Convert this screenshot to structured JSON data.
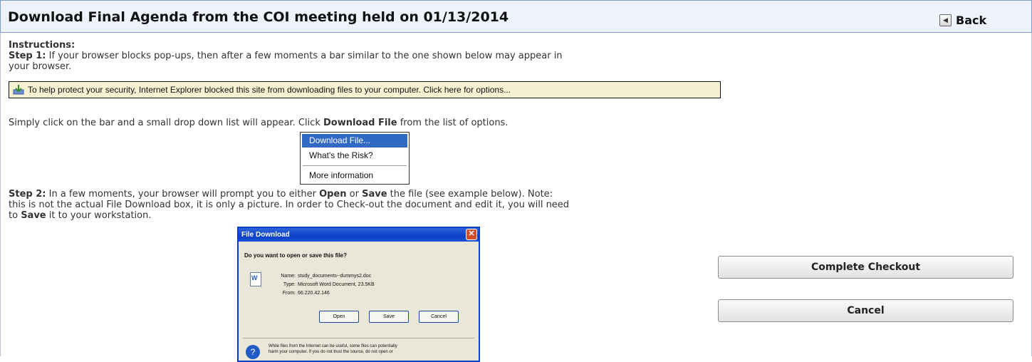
{
  "header": {
    "title": "Download Final Agenda from the COI meeting held on 01/13/2014",
    "back_label": "Back"
  },
  "instructions": {
    "heading": "Instructions:",
    "step1_label": "Step 1:",
    "step1_text_a": " If your browser blocks pop-ups, then after a few moments a bar similar to the one shown below may appear in",
    "step1_text_b": "your browser.",
    "ie_bar_text": "To help protect your security, Internet Explorer blocked this site from downloading files to your computer. Click here for options...",
    "click_text_a": "Simply click on the bar and a small drop down list will appear. Click ",
    "click_bold": "Download File",
    "click_text_b": " from the list of options.",
    "menu_items": [
      "Download File...",
      "What's the Risk?",
      "More information"
    ],
    "step2_label": "Step 2:",
    "step2_a": " In a few moments, your browser will prompt you to either ",
    "step2_open": "Open",
    "step2_or": " or ",
    "step2_save": "Save",
    "step2_b": " the file (see example below). Note:",
    "step2_line2": "this is not the actual File Download box, it is only a picture. In order to Check-out the document and edit it, you will need",
    "step2_to": "to ",
    "step2_save2": "Save",
    "step2_end": " it to your workstation."
  },
  "file_dialog": {
    "title": "File Download",
    "close": "✕",
    "question": "Do you want to open or save this file?",
    "name_label": "Name:",
    "name_value": "study_documents--dummys2.doc",
    "type_label": "Type:",
    "type_value": "Microsoft Word Document, 23.5KB",
    "from_label": "From:",
    "from_value": "66.220.42.146",
    "open_btn": "Open",
    "save_btn": "Save",
    "cancel_btn": "Cancel",
    "warning_line1": "While files from the Internet can be useful, some files can potentially",
    "warning_line2": "harm your computer. If you do not trust the source, do not open or"
  },
  "actions": {
    "complete_checkout": "Complete Checkout",
    "cancel": "Cancel"
  },
  "colors": {
    "header_bg": "#eef3fb",
    "header_border": "#7f9dc6",
    "menu_highlight": "#316ac5",
    "dialog_titlebar": "#0a3ec8"
  }
}
